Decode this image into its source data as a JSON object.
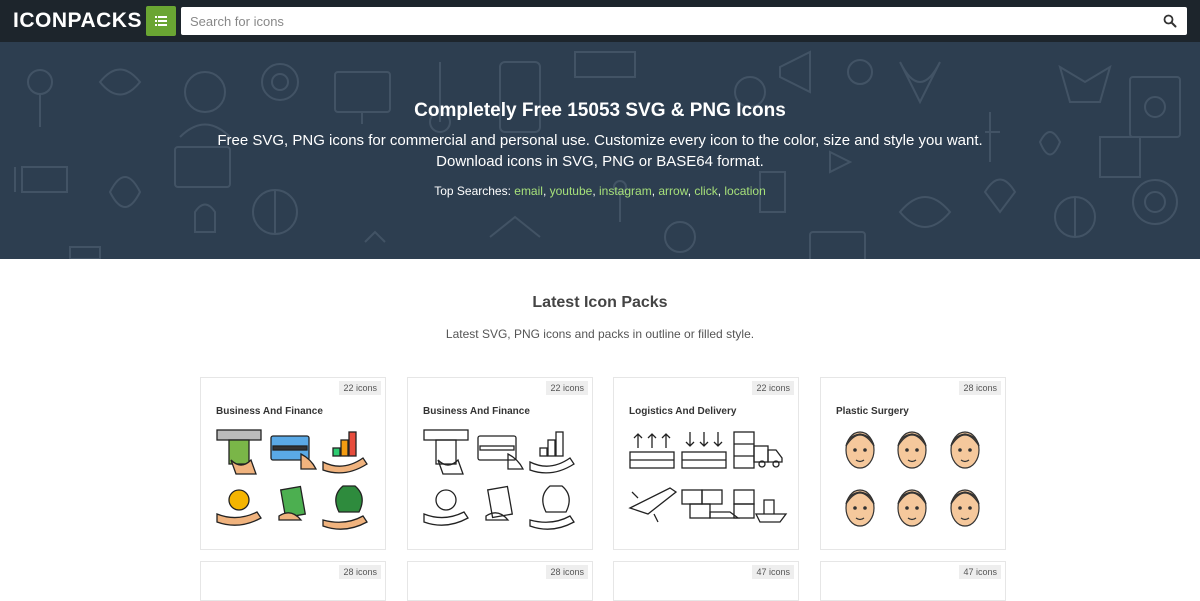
{
  "header": {
    "logo": "ICONPACKS",
    "search_placeholder": "Search for icons"
  },
  "hero": {
    "title": "Completely Free 15053 SVG & PNG Icons",
    "desc_line1": "Free SVG, PNG icons for commercial and personal use. Customize every icon to the color, size and style you want.",
    "desc_line2": "Download icons in SVG, PNG or BASE64 format.",
    "top_searches_label": "Top Searches: ",
    "top_searches": [
      "email",
      "youtube",
      "instagram",
      "arrow",
      "click",
      "location"
    ]
  },
  "latest": {
    "title": "Latest Icon Packs",
    "subtitle": "Latest SVG, PNG icons and packs in outline or filled style."
  },
  "packs": [
    {
      "count": "22 icons",
      "title": "Business And Finance",
      "style": "filled"
    },
    {
      "count": "22 icons",
      "title": "Business And Finance",
      "style": "outline"
    },
    {
      "count": "22 icons",
      "title": "Logistics And Delivery",
      "style": "logistics"
    },
    {
      "count": "28 icons",
      "title": "Plastic Surgery",
      "style": "faces"
    },
    {
      "count": "28 icons",
      "title": ""
    },
    {
      "count": "28 icons",
      "title": ""
    },
    {
      "count": "47 icons",
      "title": ""
    },
    {
      "count": "47 icons",
      "title": ""
    }
  ],
  "colors": {
    "topbar": "#1d252c",
    "accent": "#6aa533",
    "hero": "#2d3e50",
    "link": "#a6e07a"
  },
  "icons": {
    "menu": "hamburger-icon",
    "search": "magnifier-icon"
  }
}
